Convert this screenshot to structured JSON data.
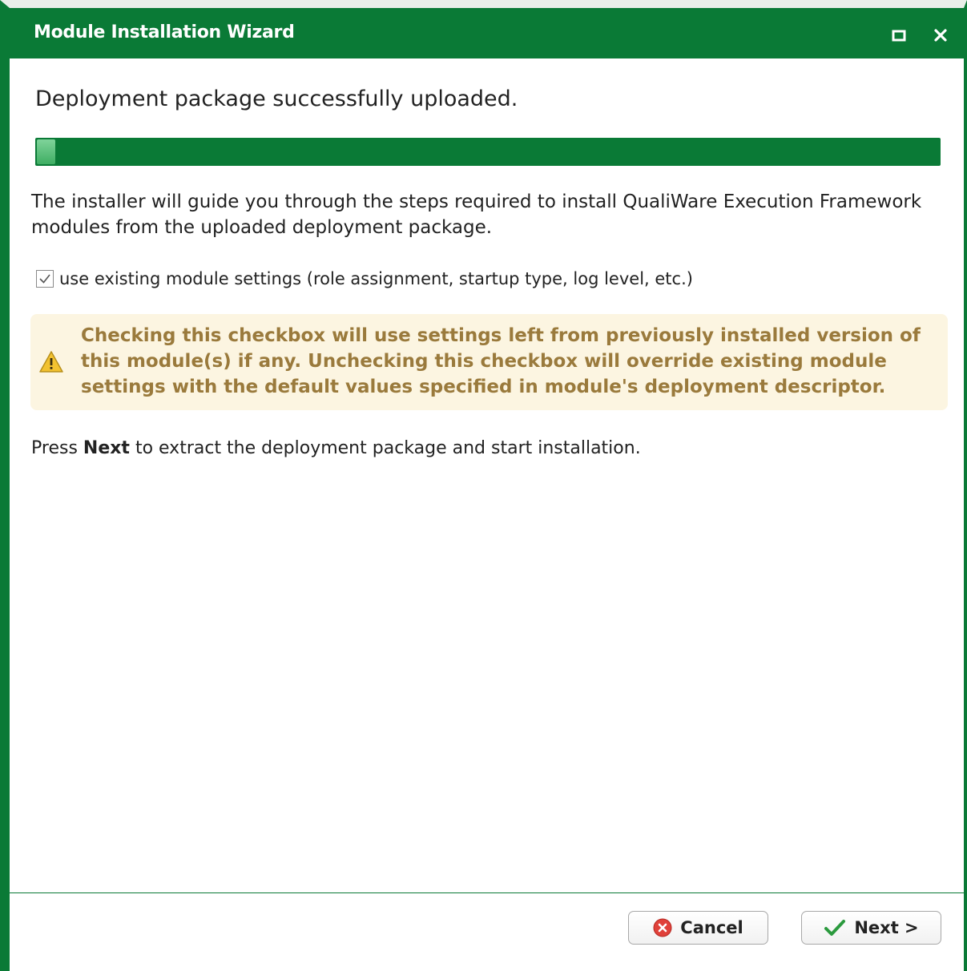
{
  "window": {
    "title": "Module Installation Wizard",
    "accent_color": "#0a7a36",
    "icons": {
      "maximize": "maximize-icon",
      "close": "close-icon"
    }
  },
  "main": {
    "heading": "Deployment package successfully uploaded.",
    "progress": {
      "value_percent": 2
    },
    "description": "The installer will guide you through the steps required to install QualiWare Execution Framework modules from the uploaded deployment package.",
    "checkbox": {
      "label": "use existing module settings (role assignment, startup type, log level, etc.)",
      "checked": true
    },
    "warning": {
      "icon": "warning-icon",
      "text": "Checking this checkbox will use settings left from previously installed version of this module(s) if any. Unchecking this checkbox will override existing module settings with the default values specified in module's deployment descriptor."
    },
    "instruction": {
      "prefix": "Press ",
      "bold": "Next",
      "suffix": " to extract the deployment package and start installation."
    }
  },
  "footer": {
    "cancel_label": "Cancel",
    "cancel_icon": "cancel-icon",
    "next_label": "Next >",
    "next_icon": "checkmark-icon"
  }
}
